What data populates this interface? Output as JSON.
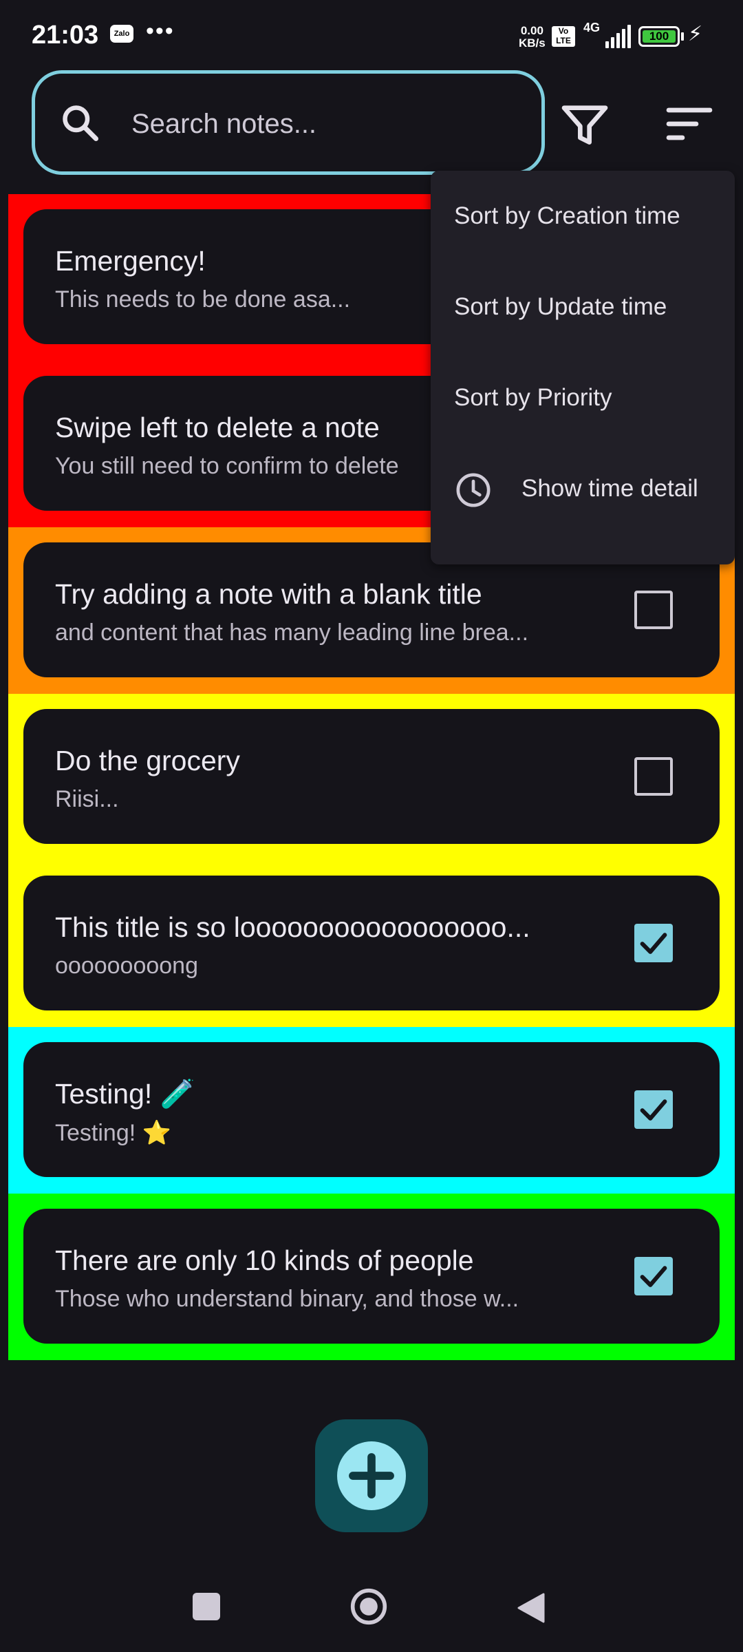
{
  "status_bar": {
    "time": "21:03",
    "app_badge": "Zalo",
    "more": "•••",
    "net_speed_value": "0.00",
    "net_speed_unit": "KB/s",
    "volte": "Vo LTE",
    "network": "4G",
    "battery": "100"
  },
  "search": {
    "placeholder": "Search notes..."
  },
  "icons": {
    "search": "search-icon",
    "filter": "filter-icon",
    "sort": "sort-icon",
    "clock": "clock-icon",
    "add": "plus-icon"
  },
  "notes": [
    {
      "title": "Emergency!",
      "body": "This needs to be done asa...",
      "color": "#ff0000",
      "checked": false
    },
    {
      "title": "Swipe left to delete a note",
      "body": "You still need to confirm to delete",
      "color": "#ff0000",
      "checked": false
    },
    {
      "title": "Try adding a note with a blank title",
      "body": "and content that has many leading line brea...",
      "color": "#ff8c00",
      "checked": false
    },
    {
      "title": "Do the grocery",
      "body": "Riisi...",
      "color": "#ffff00",
      "checked": false
    },
    {
      "title": "This title is so looooooooooooooooo...",
      "body": "ooooooooong",
      "color": "#ffff00",
      "checked": true
    },
    {
      "title": "Testing! 🧪",
      "body": "Testing! ⭐",
      "color": "#00ffff",
      "checked": true
    },
    {
      "title": "There are only 10 kinds of people",
      "body": "Those who understand binary, and those w...",
      "color": "#00ff00",
      "checked": true
    }
  ],
  "sort_menu": {
    "items": [
      {
        "label": "Sort by Creation time"
      },
      {
        "label": "Sort by Update time"
      },
      {
        "label": "Sort by Priority"
      },
      {
        "label": "Show time detail"
      }
    ]
  },
  "colors": {
    "background": "#15141a",
    "accent": "#7fcfdf",
    "fab": "#0f4f57",
    "fab_inner": "#9be6f2",
    "menu": "#211f27"
  }
}
